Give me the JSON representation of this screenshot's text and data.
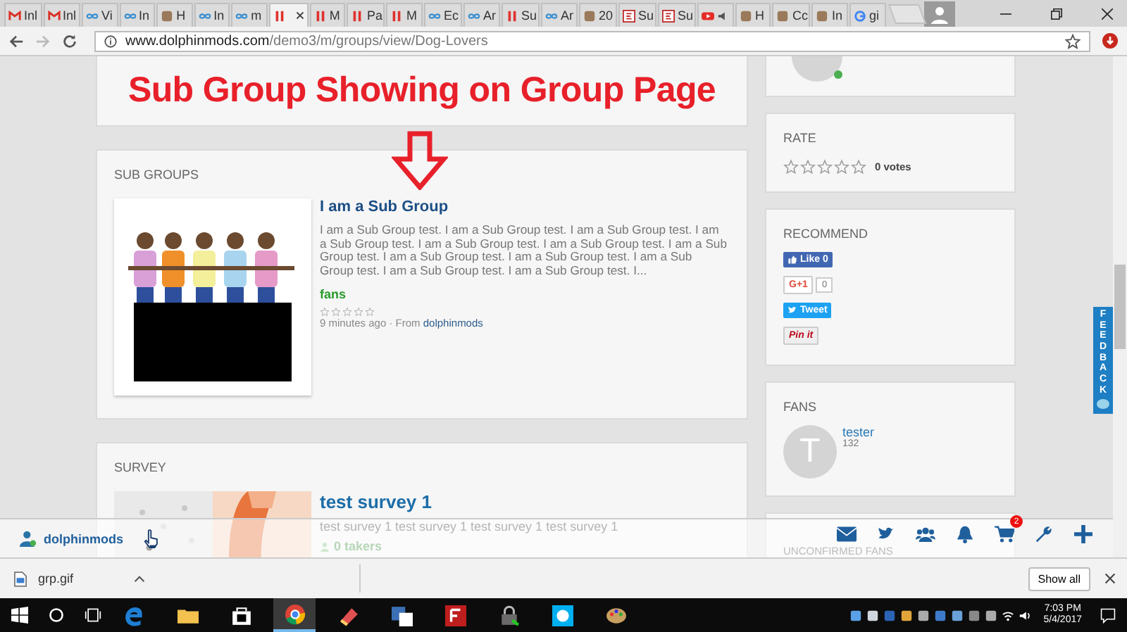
{
  "browser": {
    "tabs": [
      {
        "label": "Inl",
        "kind": "gmail",
        "selected": false
      },
      {
        "label": "Inl",
        "kind": "gmail",
        "selected": false
      },
      {
        "label": "Vi",
        "kind": "loop",
        "selected": false
      },
      {
        "label": "In",
        "kind": "loop",
        "selected": false
      },
      {
        "label": "H",
        "kind": "misc",
        "selected": false
      },
      {
        "label": "In",
        "kind": "loop",
        "selected": false
      },
      {
        "label": "m",
        "kind": "loop",
        "selected": false
      },
      {
        "kind": "bars",
        "selected": true
      },
      {
        "label": "M",
        "kind": "bars",
        "selected": false
      },
      {
        "label": "Pa",
        "kind": "bars",
        "selected": false
      },
      {
        "label": "M",
        "kind": "bars",
        "selected": false
      },
      {
        "label": "Ec",
        "kind": "loop",
        "selected": false
      },
      {
        "label": "Ar",
        "kind": "loop",
        "selected": false
      },
      {
        "label": "Su",
        "kind": "bars",
        "selected": false
      },
      {
        "label": "Ar",
        "kind": "loop",
        "selected": false
      },
      {
        "label": "20",
        "kind": "misc",
        "selected": false
      },
      {
        "label": "Su",
        "kind": "sf",
        "selected": false
      },
      {
        "label": "Su",
        "kind": "sf",
        "selected": false
      },
      {
        "kind": "yt",
        "selected": false
      },
      {
        "label": "H",
        "kind": "misc",
        "selected": false
      },
      {
        "label": "Cc",
        "kind": "misc",
        "selected": false
      },
      {
        "label": "In",
        "kind": "misc",
        "selected": false
      },
      {
        "label": "gi",
        "kind": "g",
        "selected": false
      }
    ],
    "url_host": "www.dolphinmods.com",
    "url_path": "/demo3/m/groups/view/Dog-Lovers"
  },
  "annotation": {
    "title": "Sub Group Showing on Group Page"
  },
  "sub_groups": {
    "heading": "SUB GROUPS",
    "items": [
      {
        "title": "I am a Sub Group",
        "description": "I am a Sub Group test. I am a Sub Group test. I am a Sub Group test. I am a Sub Group test. I am a Sub Group test. I am a Sub Group test. I am a Sub Group test. I am a Sub Group test. I am a Sub Group test. I am a Sub Group test. I am a Sub Group test. I am a Sub Group test. I...",
        "tag": "fans",
        "stars": 0,
        "time": "9 minutes ago · From",
        "author": "dolphinmods"
      }
    ]
  },
  "survey": {
    "heading": "SURVEY",
    "title": "test survey 1",
    "description": "test survey 1 test survey 1 test survey 1 test survey 1",
    "takers": "0 takers"
  },
  "rate": {
    "heading": "RATE",
    "stars": 0,
    "votes": "0 votes"
  },
  "recommend": {
    "heading": "RECOMMEND",
    "buttons": [
      {
        "kind": "facebook",
        "label": "Like 0"
      },
      {
        "kind": "google",
        "label": "G+1",
        "count": "0"
      },
      {
        "kind": "twitter",
        "label": "Tweet"
      },
      {
        "kind": "pinterest",
        "label": "Pin it"
      }
    ]
  },
  "fans": {
    "heading": "FANS",
    "items": [
      {
        "initial": "T",
        "name": "tester",
        "count": "132"
      }
    ]
  },
  "unconfirmed": {
    "heading": "UNCONFIRMED FANS"
  },
  "feedback": {
    "label": "FEEDBACK"
  },
  "toolbar": {
    "user": "dolphinmods",
    "icons": [
      {
        "kind": "mail"
      },
      {
        "kind": "twitter"
      },
      {
        "kind": "people"
      },
      {
        "kind": "bell"
      },
      {
        "kind": "cart",
        "badge": "2"
      },
      {
        "kind": "wrench"
      },
      {
        "kind": "plus"
      }
    ]
  },
  "downloads": {
    "file": "grp.gif",
    "show_all": "Show all"
  },
  "taskbar": {
    "apps": [
      {
        "kind": "edge",
        "selected": false
      },
      {
        "kind": "folder",
        "selected": false
      },
      {
        "kind": "store",
        "selected": false
      },
      {
        "kind": "chrome",
        "selected": true
      },
      {
        "kind": "pen",
        "selected": false
      },
      {
        "kind": "translate",
        "selected": false
      },
      {
        "kind": "filezilla",
        "selected": false
      },
      {
        "kind": "lock",
        "selected": false
      },
      {
        "kind": "skype",
        "selected": false
      },
      {
        "kind": "paint",
        "selected": false
      }
    ],
    "time": "7:03 PM",
    "date": "5/4/2017"
  }
}
